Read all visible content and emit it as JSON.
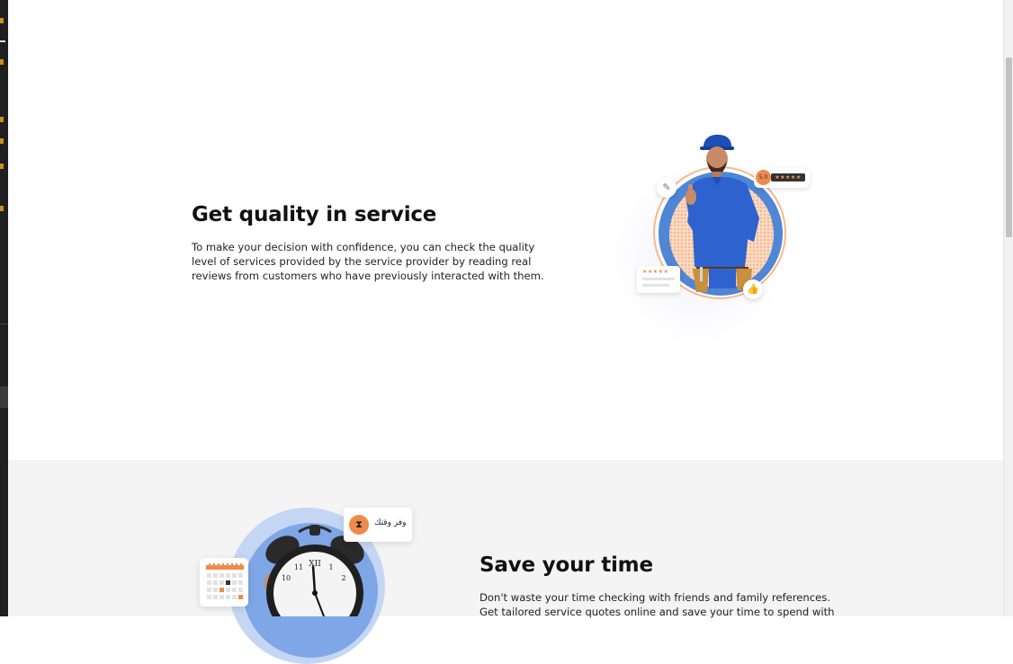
{
  "sections": [
    {
      "title": "Get quality in service",
      "lines": [
        "To make your decision with confidence, you can check the quality",
        "level of services provided by the service provider by reading real",
        "reviews from customers who have previously interacted with them."
      ],
      "illustration": {
        "rating_value": "5.0",
        "rating_stars": "★★★★★"
      }
    },
    {
      "title": "Save your time",
      "lines": [
        "Don't waste your time checking with friends and family references.",
        "Get tailored service quotes online and save your time to spend with"
      ],
      "illustration": {
        "badge_label": "وفر وقتك",
        "badge_icon": "hourglass-icon"
      }
    }
  ],
  "colors": {
    "accent_orange": "#f08a4b",
    "accent_blue": "#4f86d6",
    "section_gray": "#f4f4f4"
  }
}
